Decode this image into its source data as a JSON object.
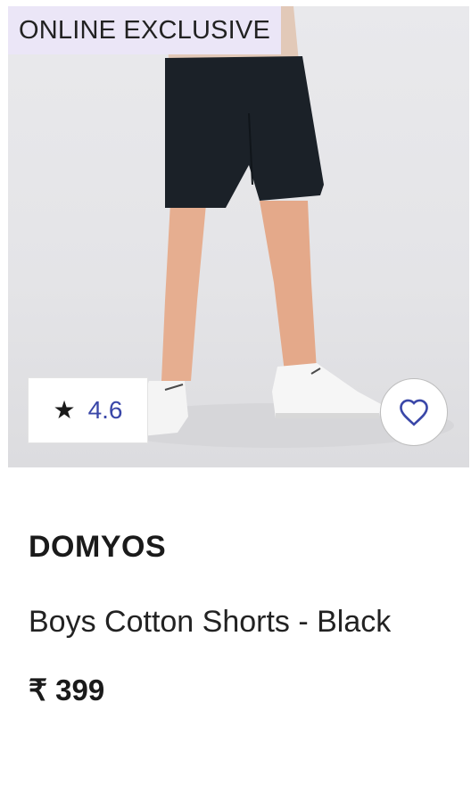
{
  "product": {
    "badge": "ONLINE EXCLUSIVE",
    "rating_star": "★",
    "rating_value": "4.6",
    "brand": "DOMYOS",
    "title": "Boys Cotton Shorts - Black",
    "price": "₹ 399"
  },
  "icons": {
    "rating": "star-icon",
    "wishlist": "heart-icon"
  },
  "colors": {
    "badge_bg": "#ebe6f7",
    "rating_text": "#3a47a8",
    "wishlist_icon": "#3a47a8"
  }
}
